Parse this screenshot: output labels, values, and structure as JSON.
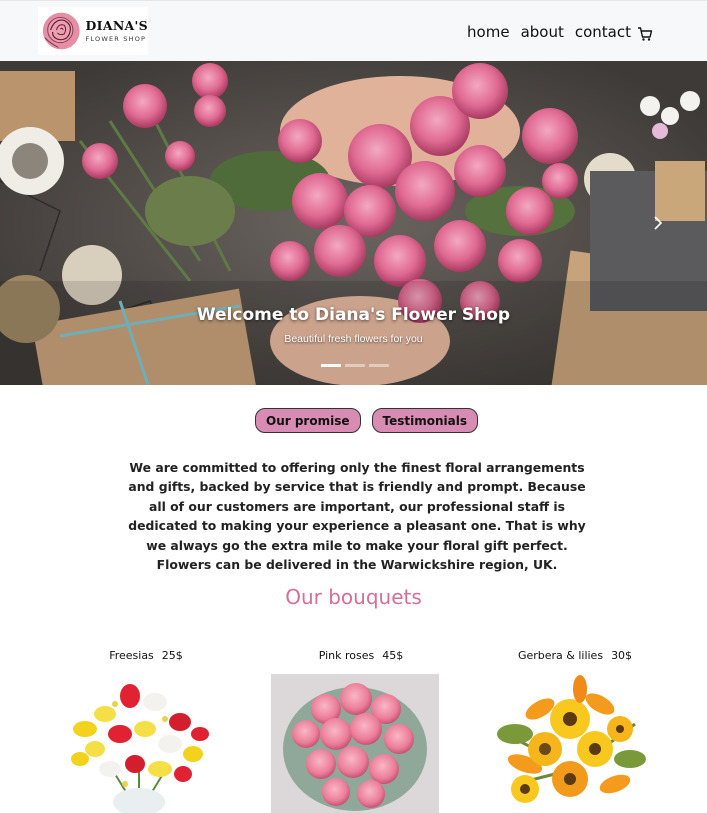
{
  "brand": {
    "name": "DIANA'S",
    "subtitle": "FLOWER SHOP",
    "icon": "rose-logo"
  },
  "nav": {
    "links": [
      "home",
      "about",
      "contact"
    ],
    "cart_icon": "cart-icon"
  },
  "hero": {
    "title": "Welcome to Diana's Flower Shop",
    "subtitle": "Beautiful fresh flowers for you",
    "slide_count": 3,
    "active_slide": 1
  },
  "tabs": {
    "promise": "Our promise",
    "testimonials": "Testimonials"
  },
  "promise_text": "We are committed to offering only the finest floral arrangements and gifts, backed by service that is friendly and prompt. Because all of our customers are important, our professional staff is dedicated to making your experience a pleasant one. That is why we always go the extra mile to make your floral gift perfect. Flowers can be delivered in the Warwickshire region, UK.",
  "bouquets": {
    "title": "Our bouquets",
    "items": [
      {
        "name": "Freesias",
        "price": "25$"
      },
      {
        "name": "Pink roses",
        "price": "45$"
      },
      {
        "name": "Gerbera & lilies",
        "price": "30$"
      }
    ]
  },
  "colors": {
    "accent": "#d98cb3",
    "title": "#d46f9a",
    "navbar": "#f7f8fa"
  }
}
